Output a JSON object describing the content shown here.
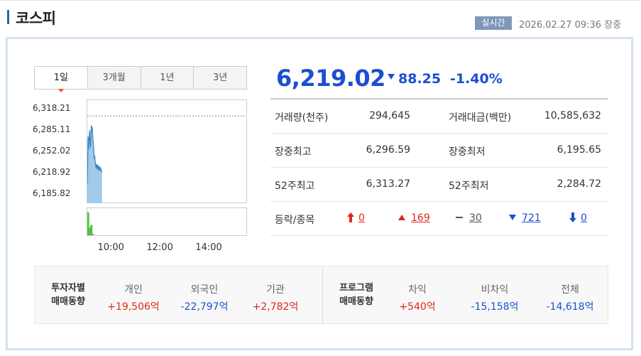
{
  "header": {
    "title": "코스피",
    "live_badge": "실시간",
    "timestamp": "2026.02.27 09:36 장중"
  },
  "tabs": [
    {
      "label": "1일",
      "active": true
    },
    {
      "label": "3개월",
      "active": false
    },
    {
      "label": "1년",
      "active": false
    },
    {
      "label": "3년",
      "active": false
    }
  ],
  "quote": {
    "price": "6,219.02",
    "change": "88.25",
    "change_pct": "-1.40%",
    "direction": "down"
  },
  "stats": {
    "volume_label": "거래량(천주)",
    "volume": "294,645",
    "amount_label": "거래대금(백만)",
    "amount": "10,585,632",
    "day_high_label": "장중최고",
    "day_high": "6,296.59",
    "day_low_label": "장중최저",
    "day_low": "6,195.65",
    "w52_high_label": "52주최고",
    "w52_high": "6,313.27",
    "w52_low_label": "52주최저",
    "w52_low": "2,284.72",
    "breadth_label": "등락/종목",
    "limit_up": "0",
    "up": "169",
    "unchanged": "30",
    "down": "721",
    "limit_down": "0"
  },
  "investors": {
    "title_line1": "투자자별",
    "title_line2": "매매동향",
    "individual_label": "개인",
    "individual": "+19,506억",
    "foreign_label": "외국인",
    "foreign": "-22,797억",
    "institution_label": "기관",
    "institution": "+2,782억"
  },
  "program": {
    "title_line1": "프로그램",
    "title_line2": "매매동향",
    "arbitrage_label": "차익",
    "arbitrage": "+540억",
    "non_arbitrage_label": "비차익",
    "non_arbitrage": "-15,158억",
    "total_label": "전체",
    "total": "-14,618억"
  },
  "colors": {
    "up": "#e0261d",
    "down": "#1b4fce",
    "chart_fill": "#8fc0e6",
    "chart_line": "#3b89c9",
    "volume_bar": "#4cc33b"
  },
  "chart_data": {
    "type": "area",
    "y_tick_labels": [
      "6,318.21",
      "6,285.11",
      "6,252.02",
      "6,218.92",
      "6,185.82"
    ],
    "y_ticks": [
      6318.21,
      6285.11,
      6252.02,
      6218.92,
      6185.82
    ],
    "ylim": [
      6172,
      6332
    ],
    "x_tick_labels": [
      "10:00",
      "12:00",
      "14:00"
    ],
    "x_ticks": [
      600,
      720,
      840
    ],
    "xlim": [
      540,
      930
    ],
    "reference_value": 6307.27,
    "x": [
      540,
      541,
      542,
      543,
      544,
      545,
      546,
      547,
      548,
      549,
      550,
      551,
      552,
      553,
      554,
      555,
      556,
      557,
      558,
      559,
      560,
      561,
      562,
      563,
      564,
      565,
      566,
      567,
      568,
      569,
      570,
      571,
      572,
      573,
      574,
      575,
      576
    ],
    "values": [
      6200,
      6240,
      6275,
      6255,
      6268,
      6280,
      6285,
      6262,
      6258,
      6276,
      6293,
      6282,
      6290,
      6278,
      6270,
      6263,
      6252,
      6240,
      6246,
      6238,
      6233,
      6228,
      6225,
      6232,
      6228,
      6224,
      6231,
      6226,
      6222,
      6229,
      6224,
      6228,
      6221,
      6226,
      6222,
      6220,
      6219
    ],
    "volume_x": [
      541,
      545,
      549,
      553
    ],
    "volume": [
      85,
      28,
      38,
      4
    ]
  }
}
